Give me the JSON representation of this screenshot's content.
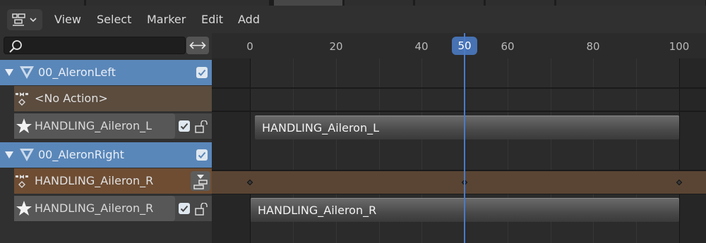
{
  "header": {
    "menus": [
      "View",
      "Select",
      "Marker",
      "Edit",
      "Add"
    ]
  },
  "search": {
    "placeholder": ""
  },
  "channels": [
    {
      "type": "object",
      "name": "00_AleronLeft",
      "checked": true
    },
    {
      "type": "action",
      "name": "<No Action>"
    },
    {
      "type": "track",
      "name": "HANDLING_Aileron_L",
      "checked": true
    },
    {
      "type": "object",
      "name": "00_AleronRight",
      "checked": true
    },
    {
      "type": "action",
      "name": "HANDLING_Aileron_R"
    },
    {
      "type": "track",
      "name": "HANDLING_Aileron_R",
      "checked": true
    }
  ],
  "timeline": {
    "ticks": [
      "0",
      "20",
      "40",
      "60",
      "80",
      "100"
    ],
    "current_frame": "50",
    "strips": [
      {
        "track": "HANDLING_Aileron_L",
        "label": "HANDLING_Aileron_L",
        "start": 2,
        "end": 100
      },
      {
        "track": "HANDLING_Aileron_R",
        "label": "HANDLING_Aileron_R",
        "start": 0,
        "end": 100
      }
    ],
    "keyframes": [
      0,
      50,
      100
    ]
  },
  "colors": {
    "object_row": "#5a87b9",
    "action_row_orange": "#6e4d33",
    "playhead": "#4772b3"
  }
}
